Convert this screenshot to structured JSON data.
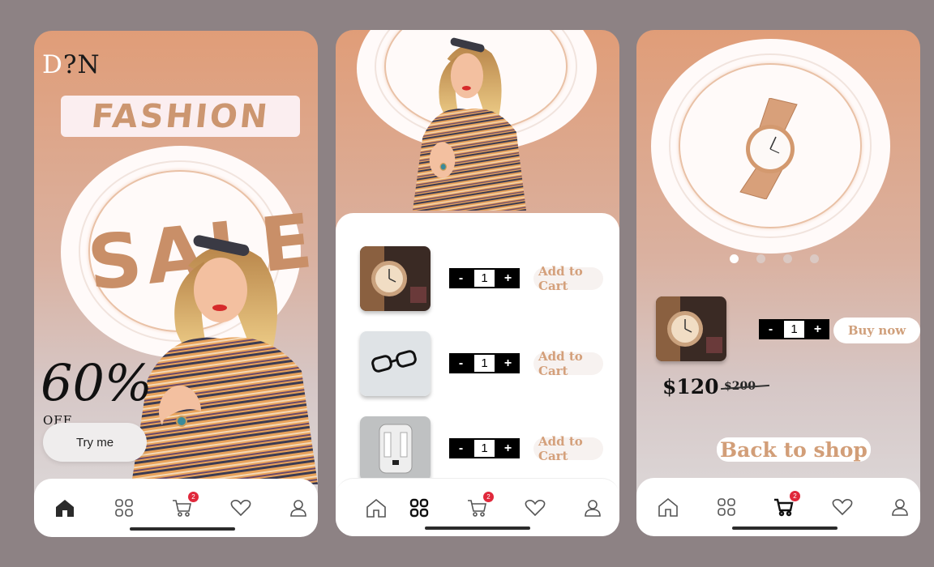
{
  "screen1": {
    "logo_first": "D",
    "logo_rest": "?N",
    "headline": "FASHION",
    "sale_word": "SALE",
    "discount": "60%",
    "discount_suffix": "OFF",
    "cta": "Try me"
  },
  "screen2": {
    "items": [
      {
        "name": "watch",
        "qty": "1",
        "minus": "-",
        "plus": "+",
        "action": "Add to Cart"
      },
      {
        "name": "glasses",
        "qty": "1",
        "minus": "-",
        "plus": "+",
        "action": "Add to Cart"
      },
      {
        "name": "backpack",
        "qty": "1",
        "minus": "-",
        "plus": "+",
        "action": "Add to Cart"
      }
    ]
  },
  "screen3": {
    "carousel_pages": 4,
    "carousel_active": 1,
    "qty": "1",
    "minus": "-",
    "plus": "+",
    "buy_label": "Buy now",
    "price": "$120",
    "old_price": "$200",
    "back_label": "Back to shop"
  },
  "nav": {
    "icons": [
      "home-icon",
      "grid-icon",
      "cart-icon",
      "heart-icon",
      "user-icon"
    ],
    "cart_badge": "2"
  },
  "colors": {
    "accent": "#d4a07b",
    "badge": "#e0283b",
    "bg": "#8d8284"
  }
}
